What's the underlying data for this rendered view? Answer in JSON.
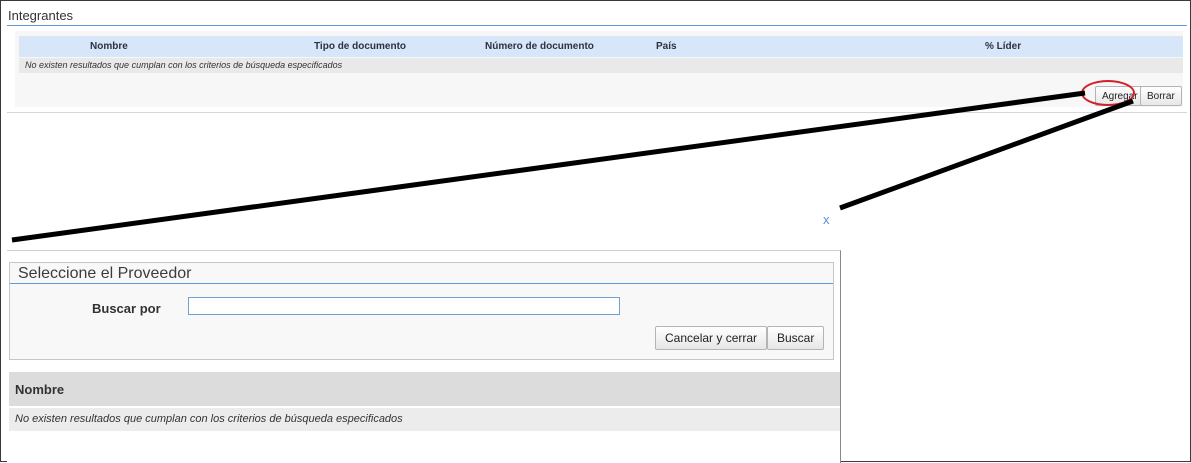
{
  "integrantes": {
    "title": "Integrantes",
    "columns": [
      "Nombre",
      "Tipo de documento",
      "Número de documento",
      "País",
      "% Líder"
    ],
    "empty_message": "No existen resultados que cumplan con los criterios de búsqueda especificados",
    "buttons": {
      "add": "Agregar",
      "delete": "Borrar"
    }
  },
  "modal": {
    "close_label": "x",
    "title": "Seleccione el Proveedor",
    "search_label": "Buscar por",
    "search_value": "",
    "buttons": {
      "cancel": "Cancelar y cerrar",
      "search": "Buscar"
    },
    "results_header": "Nombre",
    "empty_message": "No existen resultados que cumplan con los criterios de búsqueda especificados"
  },
  "colors": {
    "accent_line": "#5b9bd5",
    "table_header_bg": "#d7e6f9",
    "highlight_ring": "#d2202a",
    "callout_line": "#000000"
  }
}
